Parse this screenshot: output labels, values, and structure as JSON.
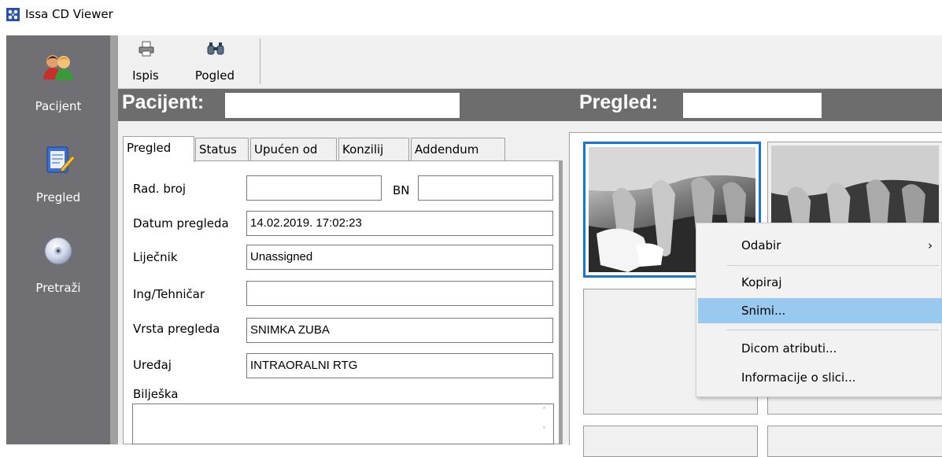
{
  "window": {
    "title": "Issa CD Viewer",
    "icon": "app-logo-icon"
  },
  "sidebar": {
    "items": [
      {
        "label": "Pacijent",
        "icon": "patients-icon"
      },
      {
        "label": "Pregled",
        "icon": "examination-notepad-icon"
      },
      {
        "label": "Pretraži",
        "icon": "cd-disc-icon"
      }
    ]
  },
  "toolbar": {
    "print_label": "Ispis",
    "view_label": "Pogled"
  },
  "infobar": {
    "patient_label": "Pacijent:",
    "exam_label": "Pregled:"
  },
  "tabs": [
    {
      "label": "Pregled",
      "active": true
    },
    {
      "label": "Status"
    },
    {
      "label": "Upućen od"
    },
    {
      "label": "Konzilij"
    },
    {
      "label": "Addendum"
    }
  ],
  "form": {
    "rad_broj_label": "Rad. broj",
    "rad_broj_value": "",
    "bn_label": "BN",
    "bn_value": "",
    "datum_label": "Datum pregleda",
    "datum_value": "14.02.2019. 17:02:23",
    "lijecnik_label": "Liječnik",
    "lijecnik_value": "Unassigned",
    "tehnicar_label": "Ing/Tehničar",
    "tehnicar_value": "",
    "vrsta_label": "Vrsta pregleda",
    "vrsta_value": "SNIMKA ZUBA",
    "uredaj_label": "Uređaj",
    "uredaj_value": "INTRAORALNI RTG",
    "biljeska_label": "Bilješka"
  },
  "context_menu": {
    "items": [
      {
        "label": "Odabir",
        "submenu": true
      },
      {
        "label": "Kopiraj"
      },
      {
        "label": "Snimi...",
        "highlighted": true
      },
      {
        "label": "Dicom atributi..."
      },
      {
        "label": "Informacije o slici..."
      }
    ],
    "submenu_arrow": "›"
  },
  "colors": {
    "sidebar_bg": "#6f6f74",
    "infobar_bg": "#6d6d6d",
    "selection_border": "#1a73d6",
    "menu_highlight": "#99c9ef"
  }
}
